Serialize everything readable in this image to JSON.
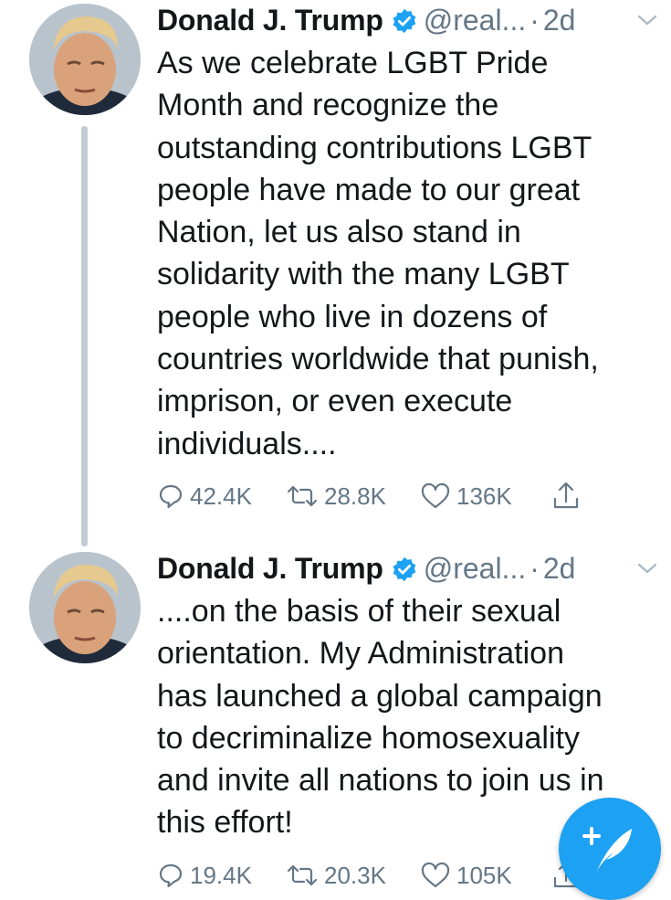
{
  "colors": {
    "accent": "#1da1f2",
    "text": "#14171a",
    "secondary": "#657786",
    "thread_line": "#c4ccd3"
  },
  "tweets": [
    {
      "author_name": "Donald J. Trump",
      "verified": true,
      "handle": "@real...",
      "separator": "·",
      "time": "2d",
      "text": "As we celebrate LGBT Pride\nMonth and recognize the\noutstanding contributions LGBT\npeople have made to our great\nNation, let us also stand in\nsolidarity with the many LGBT\npeople who live in dozens of\ncountries worldwide that punish,\nimprison, or even execute\nindividuals....",
      "replies": "42.4K",
      "retweets": "28.8K",
      "likes": "136K"
    },
    {
      "author_name": "Donald J. Trump",
      "verified": true,
      "handle": "@real...",
      "separator": "·",
      "time": "2d",
      "text": "....on the basis of their sexual\norientation. My Administration\nhas launched a global campaign\nto decriminalize homosexuality\nand invite all nations to join us in\nthis effort!",
      "replies": "19.4K",
      "retweets": "20.3K",
      "likes": "105K"
    }
  ],
  "icons": {
    "verified": "verified-badge-icon",
    "caret": "chevron-down-icon",
    "reply": "reply-icon",
    "retweet": "retweet-icon",
    "like": "heart-icon",
    "share": "share-icon",
    "compose": "compose-tweet-icon"
  }
}
